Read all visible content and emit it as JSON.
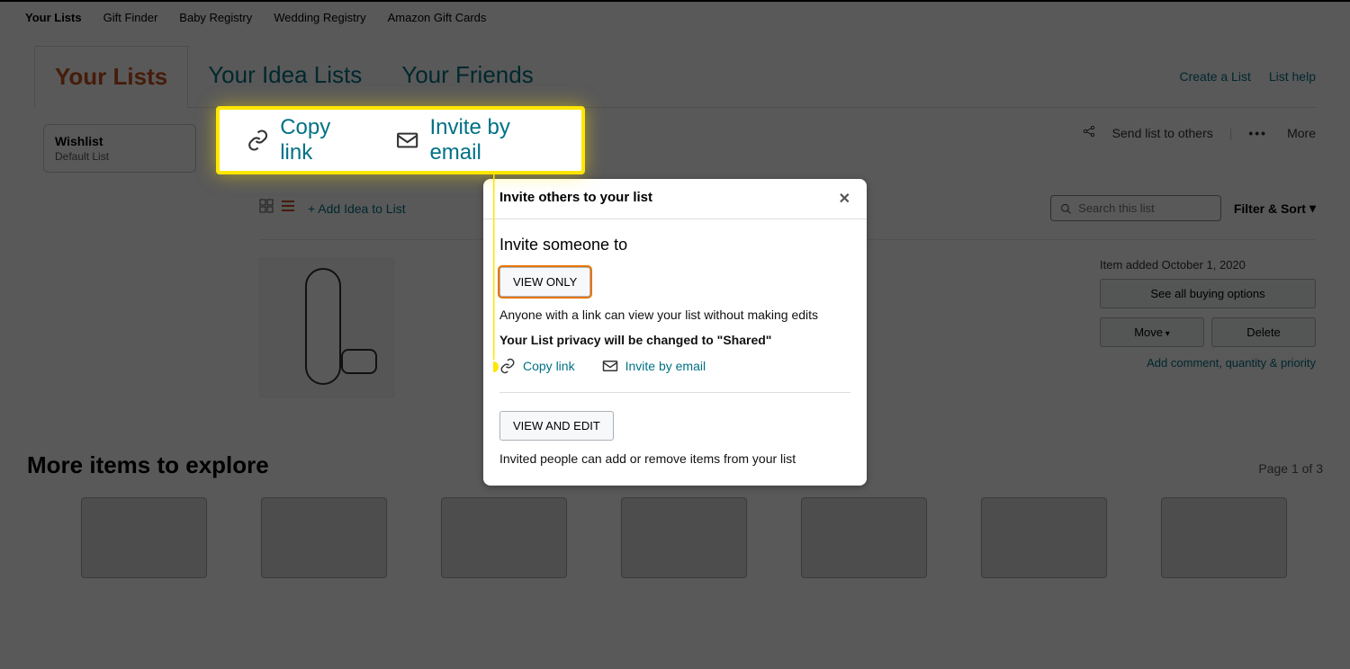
{
  "topnav": {
    "items": [
      "Your Lists",
      "Gift Finder",
      "Baby Registry",
      "Wedding Registry",
      "Amazon Gift Cards"
    ]
  },
  "tabs": {
    "items": [
      {
        "label": "Your Lists",
        "active": true
      },
      {
        "label": "Your Idea Lists",
        "active": false
      },
      {
        "label": "Your Friends",
        "active": false
      }
    ],
    "create": "Create a List",
    "help": "List help"
  },
  "sidebar": {
    "list": {
      "title": "Wishlist",
      "subtitle": "Default List"
    }
  },
  "actions": {
    "send": "Send list to others",
    "more": "More"
  },
  "toolbar": {
    "add_idea": "+ Add Idea to List",
    "search_placeholder": "Search this list",
    "filter_sort": "Filter & Sort"
  },
  "item": {
    "date": "Item added October 1, 2020",
    "see_all": "See all buying options",
    "move": "Move",
    "delete": "Delete",
    "comment": "Add comment, quantity & priority"
  },
  "more": {
    "title": "More items to explore",
    "page": "Page 1 of 3"
  },
  "highlight": {
    "copy": "Copy link",
    "invite": "Invite by email"
  },
  "modal": {
    "title": "Invite others to your list",
    "heading": "Invite someone to",
    "view_only": "VIEW ONLY",
    "view_only_note": "Anyone with a link can view your list without making edits",
    "privacy_note": "Your List privacy will be changed to \"Shared\"",
    "copy": "Copy link",
    "invite": "Invite by email",
    "view_edit": "VIEW AND EDIT",
    "view_edit_note": "Invited people can add or remove items from your list"
  }
}
